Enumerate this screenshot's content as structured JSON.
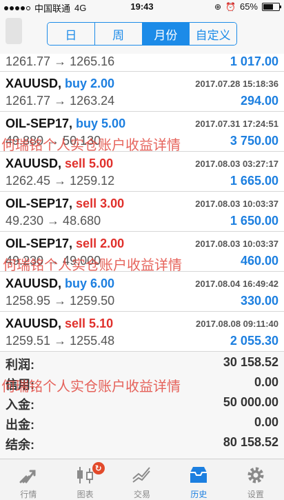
{
  "status_bar": {
    "carrier": "中国联通",
    "network": "4G",
    "time": "19:43",
    "battery_percent_text": "65%",
    "battery_level": 0.65,
    "signal_bars": 4
  },
  "period_tabs": [
    {
      "label": "日",
      "active": false
    },
    {
      "label": "周",
      "active": false
    },
    {
      "label": "月份",
      "active": true
    },
    {
      "label": "自定义",
      "active": false
    }
  ],
  "partial_row": {
    "prices": "1261.77 → 1265.16",
    "profit": "1 017.00"
  },
  "trades": [
    {
      "symbol": "XAUUSD,",
      "side": "buy 2.00",
      "side_type": "buy",
      "time": "2017.07.28 15:18:36",
      "prices": "1261.77 → 1263.24",
      "profit": "294.00"
    },
    {
      "symbol": "OIL-SEP17,",
      "side": "buy 5.00",
      "side_type": "buy",
      "time": "2017.07.31 17:24:51",
      "prices": "49.880 → 50.130",
      "profit": "3 750.00"
    },
    {
      "symbol": "XAUUSD,",
      "side": "sell 5.00",
      "side_type": "sell",
      "time": "2017.08.03 03:27:17",
      "prices": "1262.45 → 1259.12",
      "profit": "1 665.00"
    },
    {
      "symbol": "OIL-SEP17,",
      "side": "sell 3.00",
      "side_type": "sell",
      "time": "2017.08.03 10:03:37",
      "prices": "49.230 → 48.680",
      "profit": "1 650.00"
    },
    {
      "symbol": "OIL-SEP17,",
      "side": "sell 2.00",
      "side_type": "sell",
      "time": "2017.08.03 10:03:37",
      "prices": "49.230 → 49.000",
      "profit": "460.00"
    },
    {
      "symbol": "XAUUSD,",
      "side": "buy 6.00",
      "side_type": "buy",
      "time": "2017.08.04 16:49:42",
      "prices": "1258.95 → 1259.50",
      "profit": "330.00"
    },
    {
      "symbol": "XAUUSD,",
      "side": "sell 5.10",
      "side_type": "sell",
      "time": "2017.08.08 09:11:40",
      "prices": "1259.51 → 1255.48",
      "profit": "2 055.30"
    }
  ],
  "summary": [
    {
      "label": "利润:",
      "value": "30 158.52"
    },
    {
      "label": "信用:",
      "value": "0.00"
    },
    {
      "label": "入金:",
      "value": "50 000.00"
    },
    {
      "label": "出金:",
      "value": "0.00"
    },
    {
      "label": "结余:",
      "value": "80 158.52"
    }
  ],
  "watermark_text": "何瑞铭个人实仓账户收益详情",
  "tabbar": [
    {
      "label": "行情",
      "icon": "quotes-icon",
      "active": false
    },
    {
      "label": "图表",
      "icon": "chart-icon",
      "active": false,
      "badge": "↻"
    },
    {
      "label": "交易",
      "icon": "trade-icon",
      "active": false
    },
    {
      "label": "历史",
      "icon": "history-icon",
      "active": true
    },
    {
      "label": "设置",
      "icon": "settings-icon",
      "active": false
    }
  ],
  "colors": {
    "accent": "#1c8be8",
    "buy": "#1c7fe0",
    "sell": "#e0302b",
    "watermark": "#e2483f",
    "badge": "#e24a2b"
  }
}
